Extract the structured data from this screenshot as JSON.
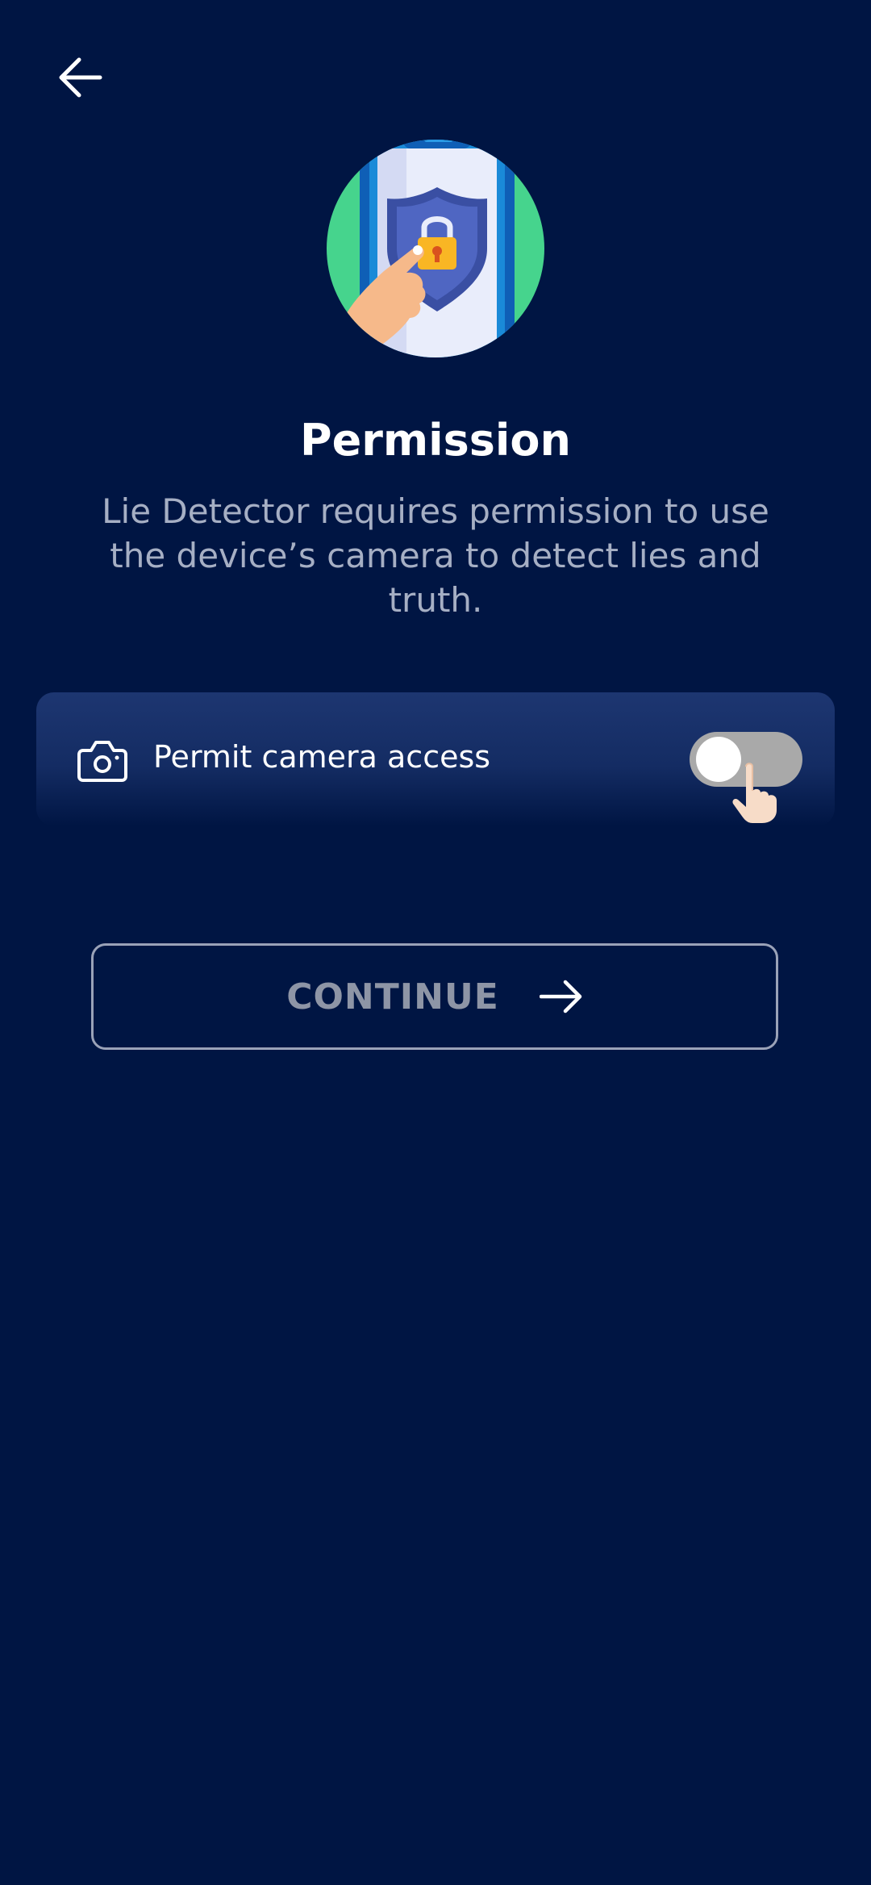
{
  "header": {
    "back_icon": "arrow-left-icon"
  },
  "hero": {
    "icon": "phone-shield-lock-illustration"
  },
  "title": "Permission",
  "description": "Lie Detector requires permission to use the device’s camera to detect lies and truth.",
  "permission": {
    "icon": "camera-icon",
    "label": "Permit camera access",
    "enabled": false,
    "hint_icon": "tap-hand-icon"
  },
  "continue_button": {
    "label": "CONTINUE",
    "icon": "arrow-right-icon"
  },
  "colors": {
    "background": "#001543",
    "card": "#1d3671",
    "toggle_off": "#a9a9a9",
    "hero_circle": "#46d48d",
    "muted_text": "#a6afc4"
  }
}
